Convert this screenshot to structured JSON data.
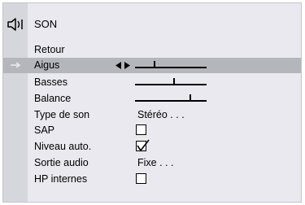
{
  "menu": {
    "title": "SON",
    "icon": "speaker-icon",
    "items": [
      {
        "label": "Retour",
        "type": "action"
      },
      {
        "label": "Aigus",
        "type": "slider",
        "level": 0.27,
        "selected": true
      },
      {
        "label": "Basses",
        "type": "slider",
        "level": 0.55
      },
      {
        "label": "Balance",
        "type": "slider",
        "level": 0.77
      },
      {
        "label": "Type de son",
        "type": "choice",
        "value": "Stéréo . . ."
      },
      {
        "label": "SAP",
        "type": "checkbox",
        "checked": false
      },
      {
        "label": "Niveau auto.",
        "type": "checkbox",
        "checked": true
      },
      {
        "label": "Sortie audio",
        "type": "choice",
        "value": "Fixe . . ."
      },
      {
        "label": "HP internes",
        "type": "checkbox",
        "checked": false
      }
    ]
  },
  "colors": {
    "panel_bg": "#e9e9ef",
    "left_strip": "#d6d6dd",
    "selected_row": "#b5b5bc"
  }
}
